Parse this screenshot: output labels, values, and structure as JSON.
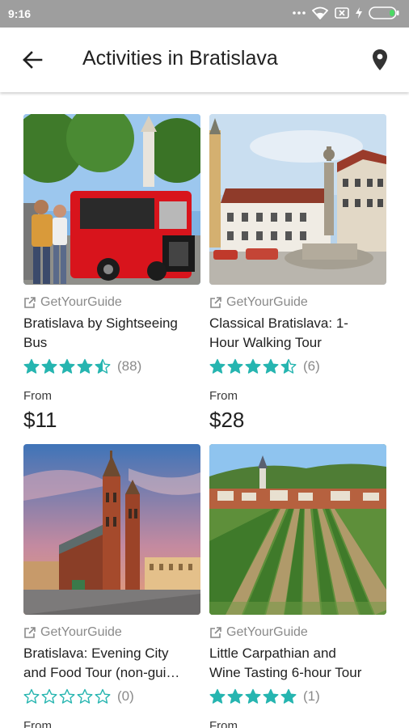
{
  "status_bar": {
    "time": "9:16"
  },
  "header": {
    "title": "Activities in Bratislava",
    "back_icon": "arrow-back-icon",
    "map_icon": "map-pin-icon"
  },
  "colors": {
    "star": "#26b5b0",
    "status_bar": "#9e9e9e"
  },
  "activities": [
    {
      "provider": "GetYourGuide",
      "title_line1": "Bratislava by Sightseeing",
      "title_line2": "Bus",
      "rating": 4.5,
      "reviews": "(88)",
      "from_label": "From",
      "price": "$11",
      "image": "red-sightseeing-train-photo"
    },
    {
      "provider": "GetYourGuide",
      "title_line1": "Classical Bratislava: 1-",
      "title_line2": "Hour Walking Tour",
      "rating": 4.5,
      "reviews": "(6)",
      "from_label": "From",
      "price": "$28",
      "image": "old-town-square-fountain-photo"
    },
    {
      "provider": "GetYourGuide",
      "title_line1": "Bratislava: Evening City",
      "title_line2": "and Food Tour (non-gui…",
      "rating": 0,
      "reviews": "(0)",
      "from_label": "From",
      "price": "",
      "image": "gothic-church-evening-photo"
    },
    {
      "provider": "GetYourGuide",
      "title_line1": "Little Carpathian and",
      "title_line2": "Wine Tasting 6-hour Tour",
      "rating": 5,
      "reviews": "(1)",
      "from_label": "From",
      "price": "",
      "image": "vineyard-village-photo"
    }
  ]
}
